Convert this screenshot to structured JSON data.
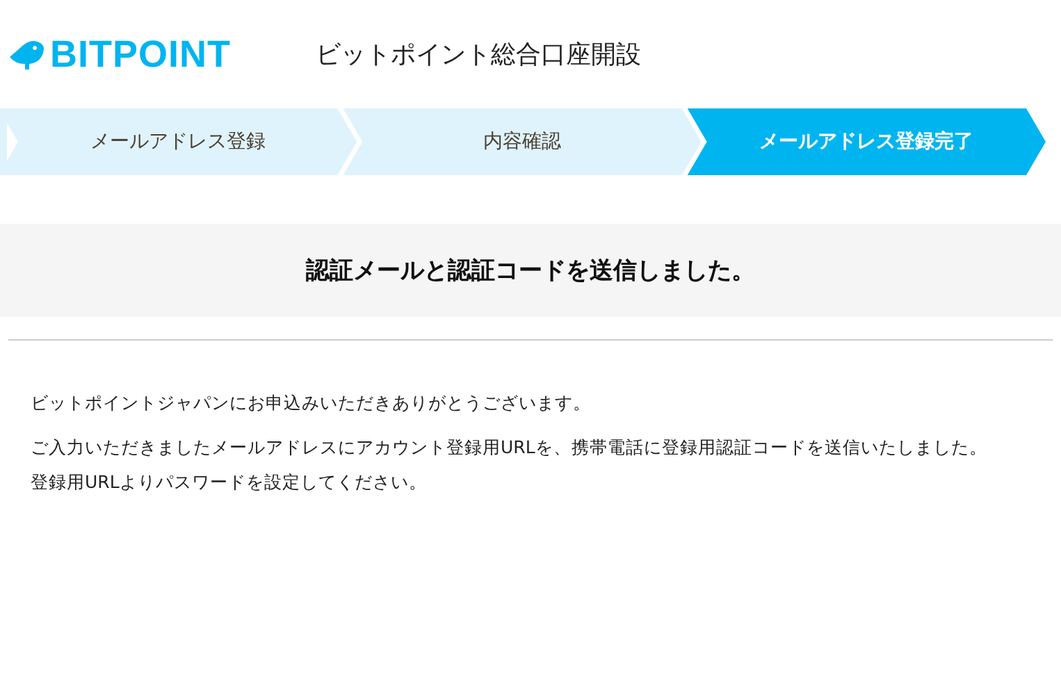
{
  "header": {
    "logo": "BITPOINT",
    "title": "ビットポイント総合口座開設"
  },
  "steps": [
    {
      "label": "メールアドレス登録",
      "selected": false
    },
    {
      "label": "内容確認",
      "selected": false
    },
    {
      "label": "メールアドレス登録完了",
      "selected": true
    }
  ],
  "heading": "認証メールと認証コードを送信しました。",
  "paragraphs": [
    {
      "lines": [
        "ビットポイントジャパンにお申込みいただきありがとうございます。"
      ]
    },
    {
      "lines": [
        "ご入力いただきましたメールアドレスにアカウント登録用URLを、携帯電話に登録用認証コードを送信いたしました。",
        "登録用URLよりパスワードを設定してください。"
      ]
    }
  ]
}
